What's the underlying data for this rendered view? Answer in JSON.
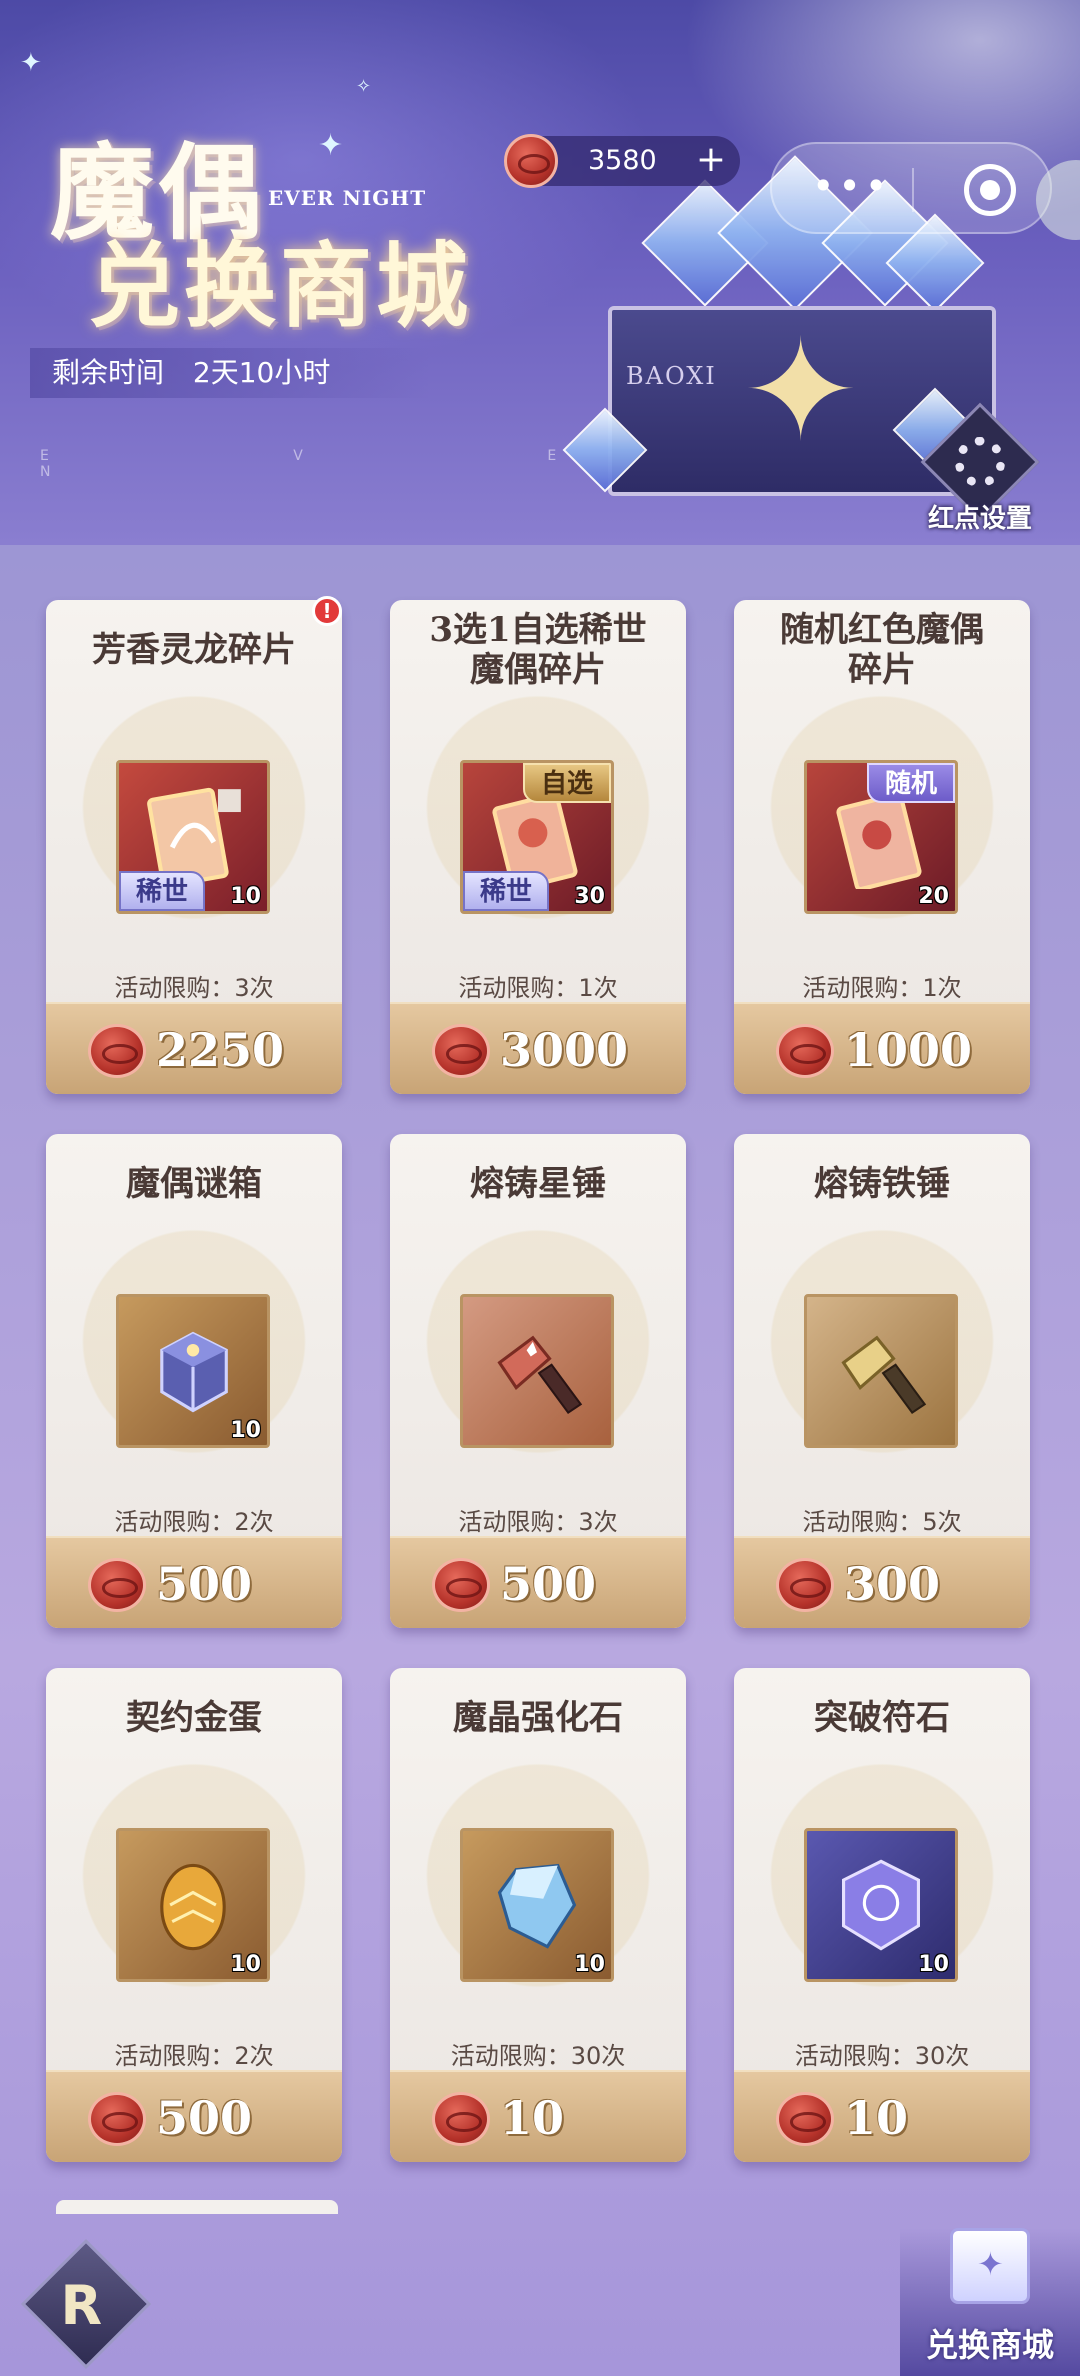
{
  "header": {
    "title_line1": "魔偶",
    "title_line2": "兑换商城",
    "subtitle": "EVER NIGHT",
    "timer_label": "剩余时间",
    "timer_value": "2天10小时",
    "currency_amount": "3580",
    "currency_plus": "+",
    "chest_label": "BAOXI",
    "red_dot_settings": "红点设置",
    "deco_letters": "E V E R N"
  },
  "capsule": {
    "more": "•••"
  },
  "shop": {
    "items": [
      {
        "name": "芳香灵龙碎片",
        "limit": "活动限购：3次",
        "price": "2250",
        "qty": "10",
        "rarity": "稀世",
        "tag": "",
        "new_badge": "!"
      },
      {
        "name": "3选1自选稀世魔偶碎片",
        "limit": "活动限购：1次",
        "price": "3000",
        "qty": "30",
        "rarity": "稀世",
        "tag": "自选"
      },
      {
        "name": "随机红色魔偶碎片",
        "limit": "活动限购：1次",
        "price": "1000",
        "qty": "20",
        "rarity": "",
        "tag": "随机"
      },
      {
        "name": "魔偶谜箱",
        "limit": "活动限购：2次",
        "price": "500",
        "qty": "10"
      },
      {
        "name": "熔铸星锤",
        "limit": "活动限购：3次",
        "price": "500",
        "qty": ""
      },
      {
        "name": "熔铸铁锤",
        "limit": "活动限购：5次",
        "price": "300",
        "qty": ""
      },
      {
        "name": "契约金蛋",
        "limit": "活动限购：2次",
        "price": "500",
        "qty": "10"
      },
      {
        "name": "魔晶强化石",
        "limit": "活动限购：30次",
        "price": "10",
        "qty": "10"
      },
      {
        "name": "突破符石",
        "limit": "活动限购：30次",
        "price": "10",
        "qty": "10"
      }
    ],
    "title_lines": {
      "item1": [
        "3选1自选稀世",
        "魔偶碎片"
      ],
      "item2": [
        "随机红色魔偶",
        "碎片"
      ]
    }
  },
  "bottom_nav": {
    "back_icon_glyph": "R",
    "exchange_label": "兑换商城"
  },
  "colors": {
    "accent_gold": "#c8a476",
    "coin_red": "#b5322a",
    "rarity_purple": "#7673c7"
  }
}
